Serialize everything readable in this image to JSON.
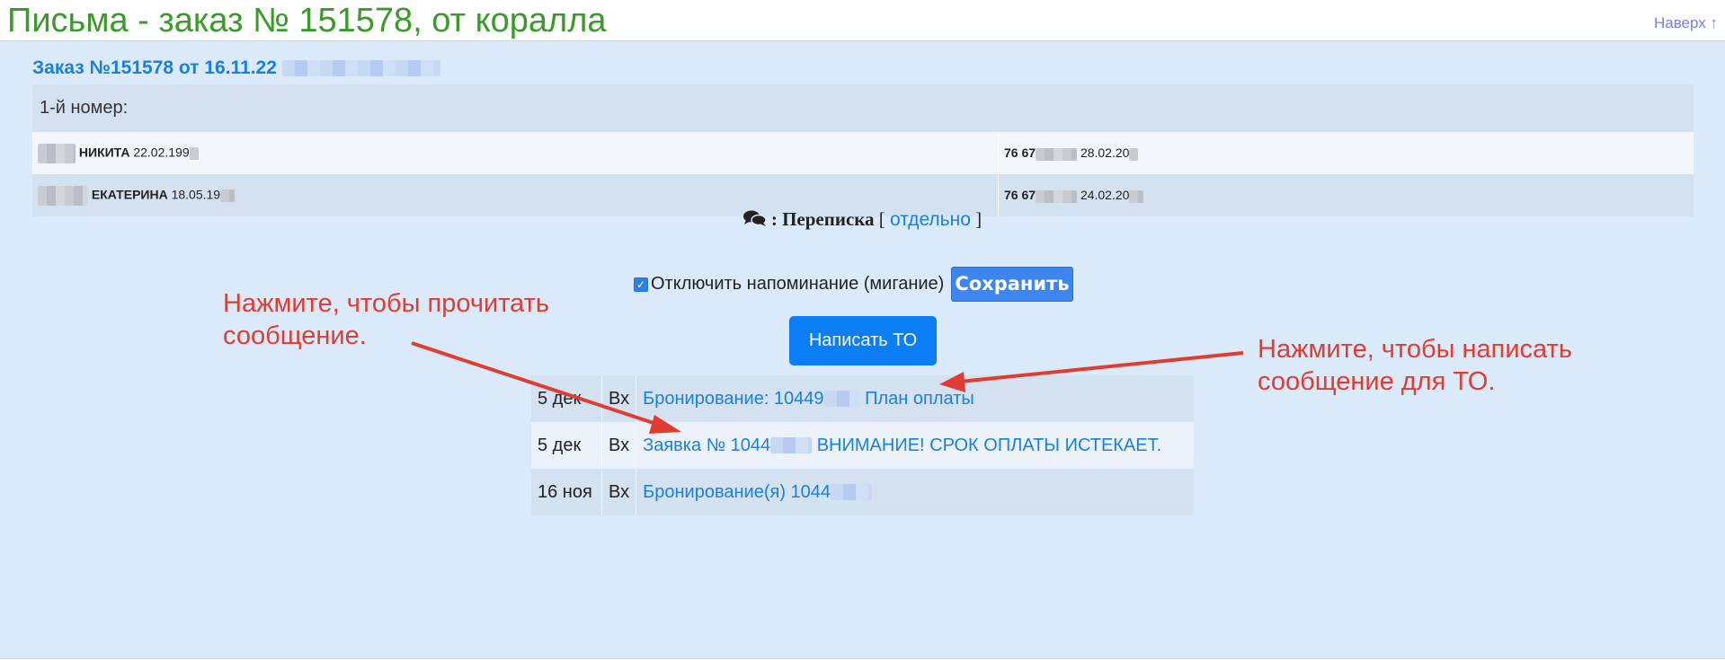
{
  "header": {
    "title": "Письма - заказ № 151578, от коралла",
    "top_link": "Наверх ↑"
  },
  "order": {
    "title": "Заказ №151578 от 16.11.22"
  },
  "rooms": {
    "label": "1-й номер:",
    "guests": [
      {
        "name": "НИКИТА",
        "dob": "22.02.199",
        "passport": "76 67",
        "issued": "28.02.20"
      },
      {
        "name": "ЕКАТЕРИНА",
        "dob": "18.05.19",
        "passport": "76 67",
        "issued": "24.02.20"
      }
    ]
  },
  "correspondence": {
    "icon": "chat-icon",
    "title": ": Переписка",
    "bracket_open": "[",
    "separate_link": "отдельно",
    "bracket_close": "]"
  },
  "reminder": {
    "checked": true,
    "label": "Отключить напоминание (мигание)",
    "save_label": "Сохранить"
  },
  "write_button": "Написать ТО",
  "messages": [
    {
      "date": "5 дек",
      "dir": "Вх",
      "subject_start": "Бронирование: 10449",
      "subject_end": "План оплаты"
    },
    {
      "date": "5 дек",
      "dir": "Вх",
      "subject_start": "Заявка № 1044",
      "subject_end": "ВНИМАНИЕ! СРОК ОПЛАТЫ ИСТЕКАЕТ."
    },
    {
      "date": "16 ноя",
      "dir": "Вх",
      "subject_start": "Бронирование(я) 1044",
      "subject_end": ""
    }
  ],
  "annotations": {
    "left": "Нажмите, чтобы прочитать\nсообщение.",
    "right": "Нажмите, чтобы написать\nсообщение для ТО."
  },
  "colors": {
    "title_green": "#3a9a2a",
    "link_blue": "#1a7fe0",
    "panel_bg": "#daeafa",
    "annotation_red": "#e03c31"
  }
}
